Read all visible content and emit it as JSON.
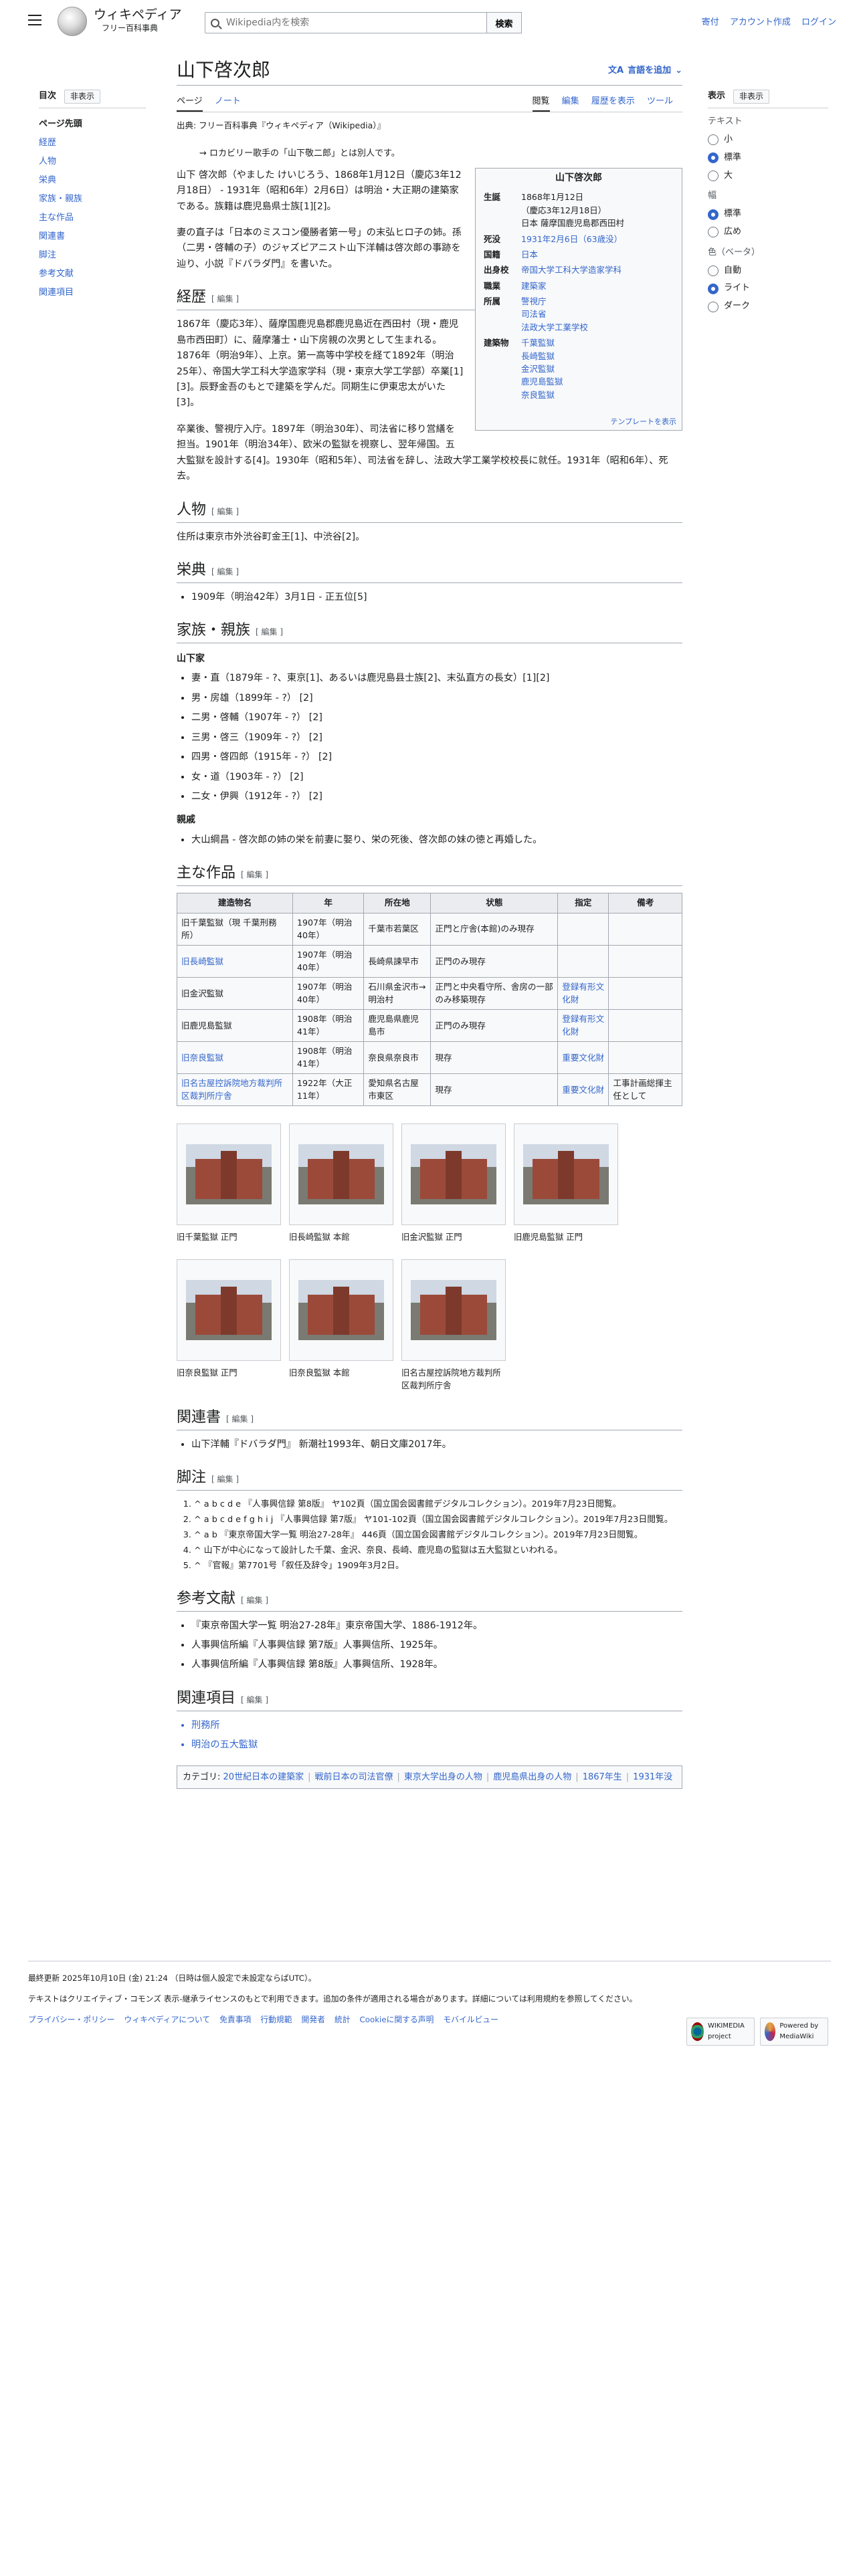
{
  "header": {
    "site_name": "ウィキペディア",
    "tagline": "フリー百科事典",
    "search_placeholder": "Wikipedia内を検索",
    "search_button": "検索",
    "links": [
      "寄付",
      "アカウント作成",
      "ログイン"
    ]
  },
  "toc": {
    "title": "目次",
    "hide": "非表示",
    "items": [
      "ページ先頭",
      "経歴",
      "人物",
      "栄典",
      "家族・親族",
      "主な作品",
      "関連書",
      "脚注",
      "参考文献",
      "関連項目"
    ]
  },
  "article": {
    "title": "山下啓次郎",
    "lang_button": "言語を追加",
    "tabs_left": [
      "ページ",
      "ノート"
    ],
    "tabs_right": [
      "閲覧",
      "編集",
      "履歴を表示",
      "ツール"
    ],
    "from": "出典: フリー百科事典『ウィキペディア（Wikipedia）』",
    "hatnote": "ロカビリー歌手の「山下敬二郎」とは別人です。",
    "lead_1": "山下 啓次郎（やました けいじろう、1868年1月12日（慶応3年12月18日） - 1931年（昭和6年）2月6日）は明治・大正期の建築家である。族籍は鹿児島県士族[1][2]。",
    "lead_2": "妻の直子は「日本のミスコン優勝者第一号」の末弘ヒロ子の姉。孫（二男・啓輔の子）のジャズピアニスト山下洋輔は啓次郎の事跡を辿り、小説『ドバラダ門』を書いた。",
    "edit_label": "[ 編集 ]",
    "sections": {
      "career": {
        "title": "経歴",
        "p1": "1867年（慶応3年）、薩摩国鹿児島郡鹿児島近在西田村（現・鹿児島市西田町）に、薩摩藩士・山下房親の次男として生まれる。1876年（明治9年）、上京。第一高等中学校を経て1892年（明治25年）、帝国大学工科大学造家学科（現・東京大学工学部）卒業[1][3]。辰野金吾のもとで建築を学んだ。同期生に伊東忠太がいた[3]。",
        "p2": "卒業後、警視庁入庁。1897年（明治30年）、司法省に移り営繕を担当。1901年（明治34年）、欧米の監獄を視察し、翌年帰国。五大監獄を設計する[4]。1930年（昭和5年）、司法省を辞し、法政大学工業学校校長に就任。1931年（昭和6年）、死去。"
      },
      "person": {
        "title": "人物",
        "p1": "住所は東京市外渋谷町金王[1]、中渋谷[2]。"
      },
      "honors": {
        "title": "栄典",
        "items": [
          "1909年（明治42年）3月1日 - 正五位[5]"
        ]
      },
      "family": {
        "title": "家族・親族",
        "sub1": "山下家",
        "items": [
          "妻・直（1879年 - ?、東京[1]、あるいは鹿児島县士族[2]、末弘直方の長女）[1][2]",
          "男・房雄（1899年 - ?） [2]",
          "二男・啓輔（1907年 - ?） [2]",
          "三男・啓三（1909年 - ?） [2]",
          "四男・啓四郎（1915年 - ?） [2]",
          "女・道（1903年 - ?） [2]",
          "二女・伊興（1912年 - ?） [2]"
        ],
        "sub2": "親戚",
        "items2": [
          "大山綱昌 - 啓次郎の姉の栄を前妻に娶り、栄の死後、啓次郎の妹の徳と再婚した。"
        ]
      },
      "works": {
        "title": "主な作品",
        "headers": [
          "建造物名",
          "年",
          "所在地",
          "状態",
          "指定",
          "備考"
        ],
        "rows": [
          [
            "旧千葉監獄（現 千葉刑務所）",
            "1907年（明治40年）",
            "千葉市若葉区",
            "正門と庁舎(本館)のみ現存",
            "",
            ""
          ],
          [
            "旧長崎監獄",
            "1907年（明治40年）",
            "長崎県諫早市",
            "正門のみ現存",
            "",
            ""
          ],
          [
            "旧金沢監獄",
            "1907年（明治40年）",
            "石川県金沢市→明治村",
            "正門と中央看守所、舎房の一部のみ移築現存",
            "登録有形文化財",
            ""
          ],
          [
            "旧鹿児島監獄",
            "1908年（明治41年）",
            "鹿児島県鹿児島市",
            "正門のみ現存",
            "登録有形文化財",
            ""
          ],
          [
            "旧奈良監獄",
            "1908年（明治41年）",
            "奈良県奈良市",
            "現存",
            "重要文化財",
            ""
          ],
          [
            "旧名古屋控訴院地方裁判所区裁判所庁舎",
            "1922年（大正11年）",
            "愛知県名古屋市東区",
            "現存",
            "重要文化財",
            "工事計画総揮主任として"
          ]
        ],
        "gallery": [
          "旧千葉監獄 正門",
          "旧長崎監獄 本館",
          "旧金沢監獄 正門",
          "旧鹿児島監獄 正門",
          "旧奈良監獄 正門",
          "旧奈良監獄 本館",
          "旧名古屋控訴院地方裁判所区裁判所庁舎"
        ]
      },
      "books": {
        "title": "関連書",
        "items": [
          "山下洋輔『ドバラダ門』 新潮社1993年、朝日文庫2017年。"
        ]
      },
      "notes": {
        "title": "脚注",
        "items": [
          "^ a b c d e 『人事興信録 第8版』 ヤ102頁（国立国会図書館デジタルコレクション）。2019年7月23日閲覧。",
          "^ a b c d e f g h i j 『人事興信録 第7版』 ヤ101-102頁（国立国会図書館デジタルコレクション）。2019年7月23日閲覧。",
          "^ a b 『東京帝国大学一覧 明治27-28年』 446頁（国立国会図書館デジタルコレクション）。2019年7月23日閲覧。",
          "^ 山下が中心になって設計した千葉、金沢、奈良、長崎、鹿児島の監獄は五大監獄といわれる。",
          "^ 『官報』第7701号「叙任及辞令」1909年3月2日。"
        ]
      },
      "refs": {
        "title": "参考文献",
        "items": [
          "『東京帝国大学一覧 明治27-28年』東京帝国大学、1886-1912年。",
          "人事興信所編『人事興信録 第7版』人事興信所、1925年。",
          "人事興信所編『人事興信録 第8版』人事興信所、1928年。"
        ]
      },
      "related": {
        "title": "関連項目",
        "items": [
          "刑務所",
          "明治の五大監獄"
        ]
      }
    },
    "categories_label": "カテゴリ:",
    "categories": [
      "20世紀日本の建築家",
      "戦前日本の司法官僚",
      "東京大学出身の人物",
      "鹿児島県出身の人物",
      "1867年生",
      "1931年没"
    ]
  },
  "infobox": {
    "title": "山下啓次郎",
    "rows": [
      [
        "生誕",
        "1868年1月12日\n（慶応3年12月18日）\n日本 薩摩国鹿児島郡西田村"
      ],
      [
        "死没",
        "1931年2月6日（63歳没）"
      ],
      [
        "国籍",
        "日本"
      ],
      [
        "出身校",
        "帝国大学工科大学造家学科"
      ],
      [
        "職業",
        "建築家"
      ],
      [
        "所属",
        "警視庁\n司法省\n法政大学工業学校"
      ],
      [
        "建築物",
        "千葉監獄\n長崎監獄\n金沢監獄\n鹿児島監獄\n奈良監獄"
      ]
    ],
    "template": "テンプレートを表示"
  },
  "appearance": {
    "title": "表示",
    "hide": "非表示",
    "text_label": "テキスト",
    "text_opts": [
      "小",
      "標準",
      "大"
    ],
    "width_label": "幅",
    "width_opts": [
      "標準",
      "広め"
    ],
    "color_label": "色（ベータ）",
    "color_opts": [
      "自動",
      "ライト",
      "ダーク"
    ]
  },
  "footer": {
    "updated": "最終更新 2025年10月10日 (金) 21:24 （日時は個人設定で未設定ならばUTC）。",
    "license": "テキストはクリエイティブ・コモンズ 表示-継承ライセンスのもとで利用できます。追加の条件が適用される場合があります。詳細については利用規約を参照してください。",
    "links": [
      "プライバシー・ポリシー",
      "ウィキペディアについて",
      "免責事項",
      "行動規範",
      "開発者",
      "統計",
      "Cookieに関する声明",
      "モバイルビュー"
    ],
    "badge1": "WIKIMEDIA project",
    "badge2": "Powered by MediaWiki"
  }
}
